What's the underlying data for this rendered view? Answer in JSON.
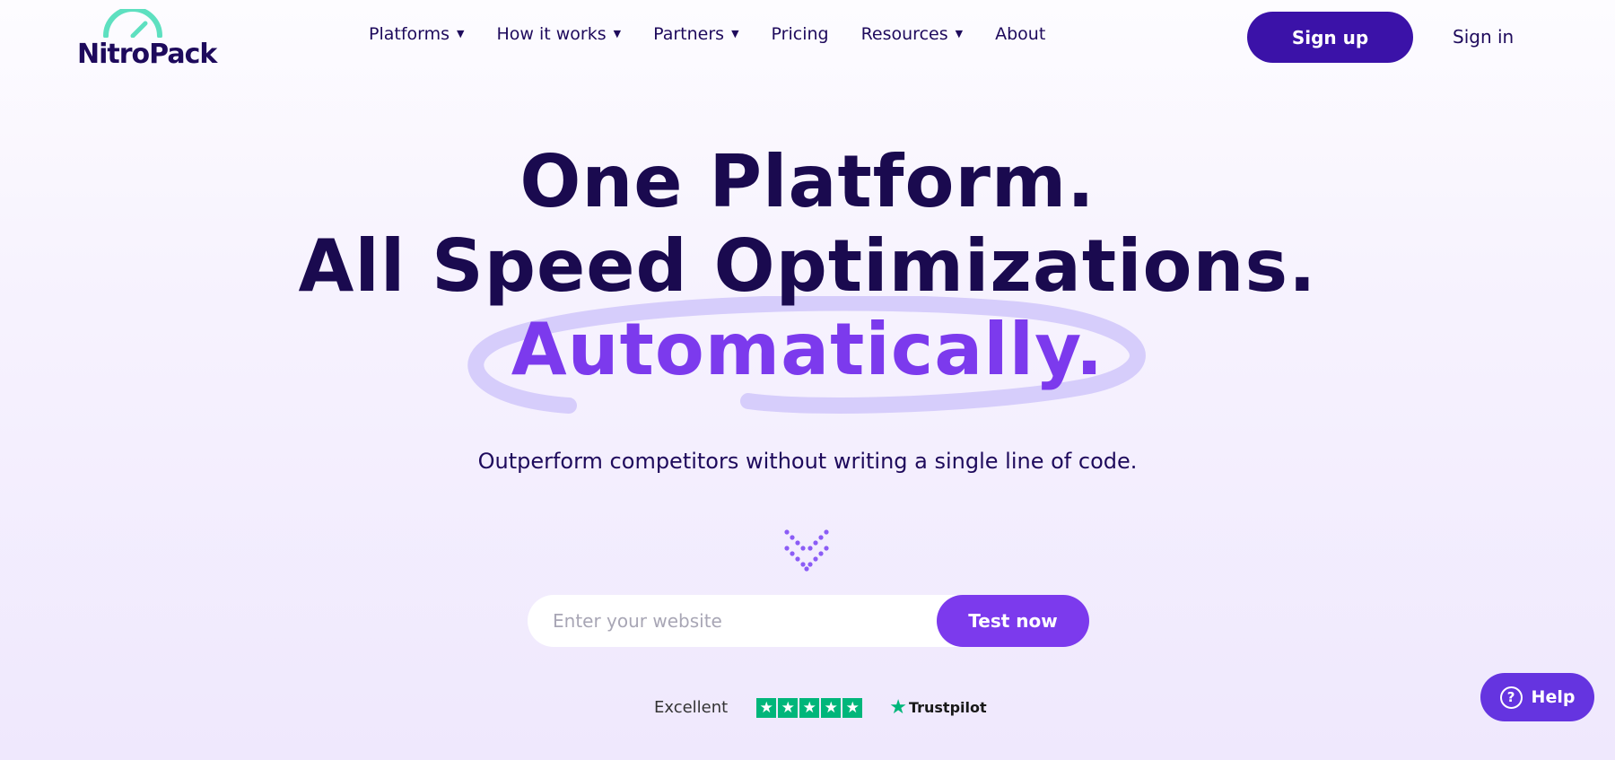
{
  "brand": {
    "name": "NitroPack",
    "accent": "#5ee0c0"
  },
  "nav": {
    "items": [
      {
        "label": "Platforms",
        "dropdown": true
      },
      {
        "label": "How it works",
        "dropdown": true
      },
      {
        "label": "Partners",
        "dropdown": true
      },
      {
        "label": "Pricing",
        "dropdown": false
      },
      {
        "label": "Resources",
        "dropdown": true
      },
      {
        "label": "About",
        "dropdown": false
      }
    ],
    "signup_label": "Sign up",
    "signin_label": "Sign in"
  },
  "hero": {
    "line1": "One Platform.",
    "line2": "All Speed Optimizations.",
    "line3": "Automatically.",
    "subtitle": "Outperform competitors without writing a single line of code."
  },
  "form": {
    "placeholder": "Enter your website",
    "value": "",
    "button_label": "Test now"
  },
  "trust": {
    "rating_label": "Excellent",
    "stars": 5,
    "brand": "Trustpilot"
  },
  "help": {
    "label": "Help",
    "icon": "question-icon"
  },
  "colors": {
    "primary": "#3b12a8",
    "purple": "#7c3aed",
    "text": "#1e0a5c",
    "trustpilot_green": "#00b67a"
  }
}
